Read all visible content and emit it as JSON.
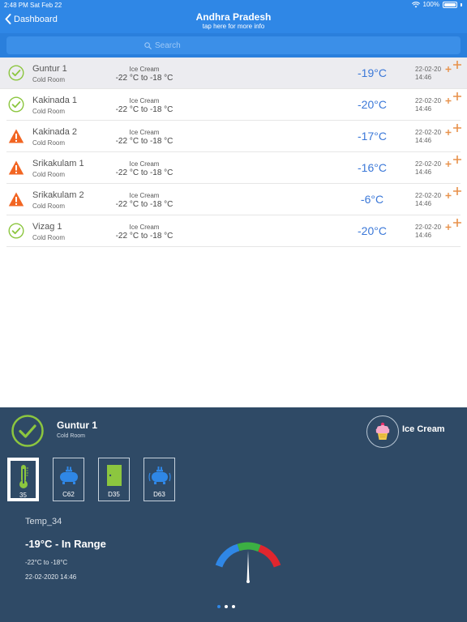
{
  "status_bar": {
    "time": "2:48 PM",
    "date": "Sat Feb 22",
    "battery": "100%"
  },
  "nav": {
    "back_label": "Dashboard",
    "title": "Andhra Pradesh",
    "subtitle": "tap here for more info"
  },
  "search": {
    "placeholder": "Search"
  },
  "rooms": [
    {
      "name": "Guntur 1",
      "type": "Cold Room",
      "product": "Ice Cream",
      "range": "-22 °C to -18 °C",
      "temp": "-19°C",
      "date": "22-02-20",
      "time": "14:46",
      "status": "ok"
    },
    {
      "name": "Kakinada 1",
      "type": "Cold Room",
      "product": "Ice Cream",
      "range": "-22 °C to -18 °C",
      "temp": "-20°C",
      "date": "22-02-20",
      "time": "14:46",
      "status": "ok"
    },
    {
      "name": "Kakinada 2",
      "type": "Cold Room",
      "product": "Ice Cream",
      "range": "-22 °C to -18 °C",
      "temp": "-17°C",
      "date": "22-02-20",
      "time": "14:46",
      "status": "warning"
    },
    {
      "name": "Srikakulam 1",
      "type": "Cold Room",
      "product": "Ice Cream",
      "range": "-22 °C to -18 °C",
      "temp": "-16°C",
      "date": "22-02-20",
      "time": "14:46",
      "status": "warning"
    },
    {
      "name": "Srikakulam 2",
      "type": "Cold Room",
      "product": "Ice Cream",
      "range": "-22 °C to -18 °C",
      "temp": "-6°C",
      "date": "22-02-20",
      "time": "14:46",
      "status": "warning"
    },
    {
      "name": "Vizag 1",
      "type": "Cold Room",
      "product": "Ice Cream",
      "range": "-22 °C to -18 °C",
      "temp": "-20°C",
      "date": "22-02-20",
      "time": "14:46",
      "status": "ok"
    }
  ],
  "detail": {
    "name": "Guntur 1",
    "type": "Cold Room",
    "product": "Ice Cream",
    "sensors": [
      {
        "label": "35",
        "icon": "thermometer-icon",
        "active": true
      },
      {
        "label": "C62",
        "icon": "compressor-icon",
        "active": false
      },
      {
        "label": "D35",
        "icon": "door-icon",
        "active": false
      },
      {
        "label": "D63",
        "icon": "compressor-vibration-icon",
        "active": false
      }
    ],
    "sensor_name": "Temp_34",
    "status_text": "-19°C - In Range",
    "range_text": "-22°C to -18°C",
    "datetime_text": "22-02-2020  14:46",
    "gauge_level": 0.5
  },
  "colors": {
    "header": "#2f87e6",
    "panel": "#2f4a66",
    "ok": "#8cc63f",
    "warning": "#f26522",
    "temp": "#3b78d8",
    "plus": "#e8914a"
  },
  "pager": {
    "count": 3,
    "active": 0
  }
}
